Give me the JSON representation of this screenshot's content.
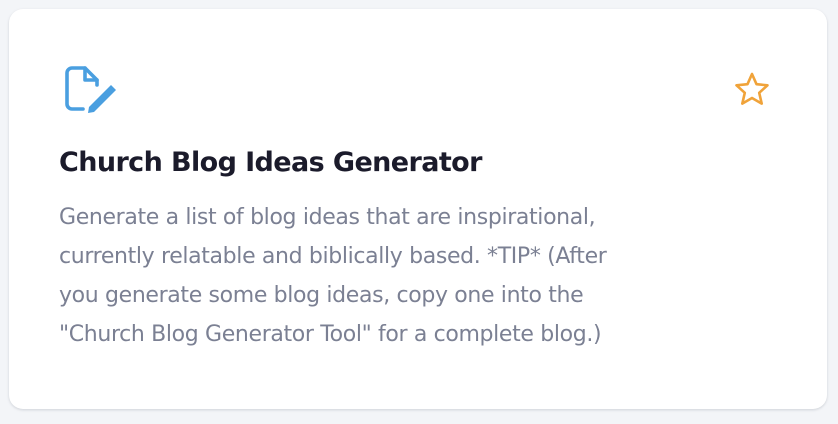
{
  "card": {
    "title": "Church Blog Ideas Generator",
    "description_lines": [
      "Generate a list of blog ideas that are inspirational,",
      "currently relatable and biblically based. *TIP* (After",
      "you generate some blog ideas, copy one into the",
      "\"Church Blog Generator Tool\" for a complete blog.)"
    ],
    "icon": "document-edit-icon",
    "favorite_icon": "star-outline-icon"
  },
  "colors": {
    "icon_blue": "#4a9fe0",
    "star_orange": "#f0a33a",
    "title": "#1b1b2b",
    "description": "#7b8093"
  }
}
